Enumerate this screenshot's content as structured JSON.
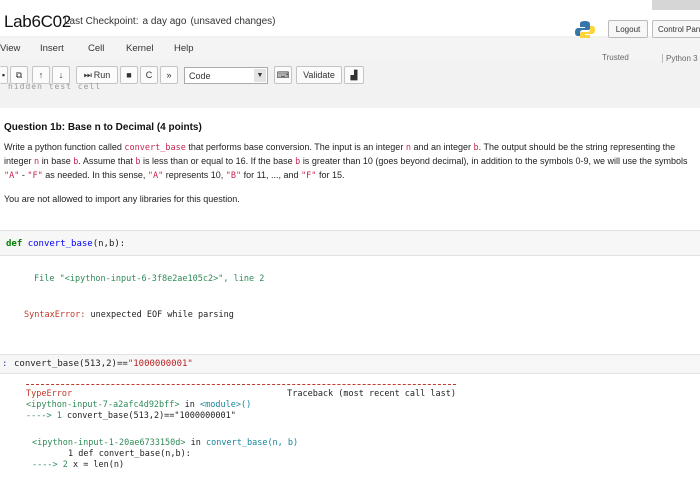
{
  "header": {
    "notebook_name": "Lab6C02",
    "checkpoint_label": "Last Checkpoint:",
    "checkpoint_time": "a day ago",
    "unsaved": "(unsaved changes)",
    "logout": "Logout",
    "control_panel": "Control Pan"
  },
  "menu": {
    "items": [
      "View",
      "Insert",
      "Cell",
      "Kernel",
      "Help"
    ],
    "trusted": "Trusted",
    "kernel_name": "Python 3"
  },
  "toolbar": {
    "run_label": "Run",
    "cell_type": "Code",
    "validate_label": "Validate"
  },
  "hidden_cell": "hidden test cell",
  "question": {
    "title": "Question 1b: Base n to Decimal (4 points)",
    "p1": "Write a python function called",
    "fn_name": "convert_base",
    "p2": "that performs base conversion. The input is an integer",
    "var_n": "n",
    "p3": "and an integer",
    "var_b": "b",
    "p4": ". The output should be the string representing the integer",
    "p5": "in base",
    "p6": ". Assume that",
    "p7": "is less than or equal to 16. If the base",
    "p8": "is greater than 10 (goes beyond decimal), in addition to the symbols 0-9, we will use the symbols",
    "sym_a": "\"A\"",
    "dash": "-",
    "sym_f": "\"F\"",
    "p9": "as needed. In this sense,",
    "p10": "represents 10,",
    "sym_b": "\"B\"",
    "p11": "for 11, ..., and",
    "p12": "for 15.",
    "note": "You are not allowed to import any libraries for this question."
  },
  "cell1": {
    "kw": "def",
    "fn": "convert_base",
    "args": "(n,b):",
    "file_label": "File",
    "file_name": "\"<ipython-input-6-3f8e2ae105c2>\"",
    "line_info": ", line 2",
    "error_type": "SyntaxError:",
    "error_msg": "unexpected EOF while parsing"
  },
  "cell2": {
    "prompt": ":",
    "code_fn": "convert_base",
    "code_args": "(513,2)==",
    "code_str": "\"1000000001\"",
    "tb_error": "TypeError",
    "tb_header": "Traceback (most recent call last)",
    "tb_src1": "<ipython-input-7-a2afc4d92bff>",
    "tb_in": "in",
    "tb_module": "<module>()",
    "tb_arrow1": "----> 1",
    "tb_code1": "convert_base(513,2)==\"1000000001\"",
    "tb_src2": "<ipython-input-1-20ae6733150d>",
    "tb_in2": "in",
    "tb_fn2": "convert_base(n, b)",
    "tb_line1": "1 def convert_base(n,b):",
    "tb_arrow2": "----> 2",
    "tb_code2": "x = len(n)"
  },
  "colors": {
    "accent": "#1d4aa8",
    "error": "#c0392b",
    "code_bg": "#f7f7f7"
  }
}
